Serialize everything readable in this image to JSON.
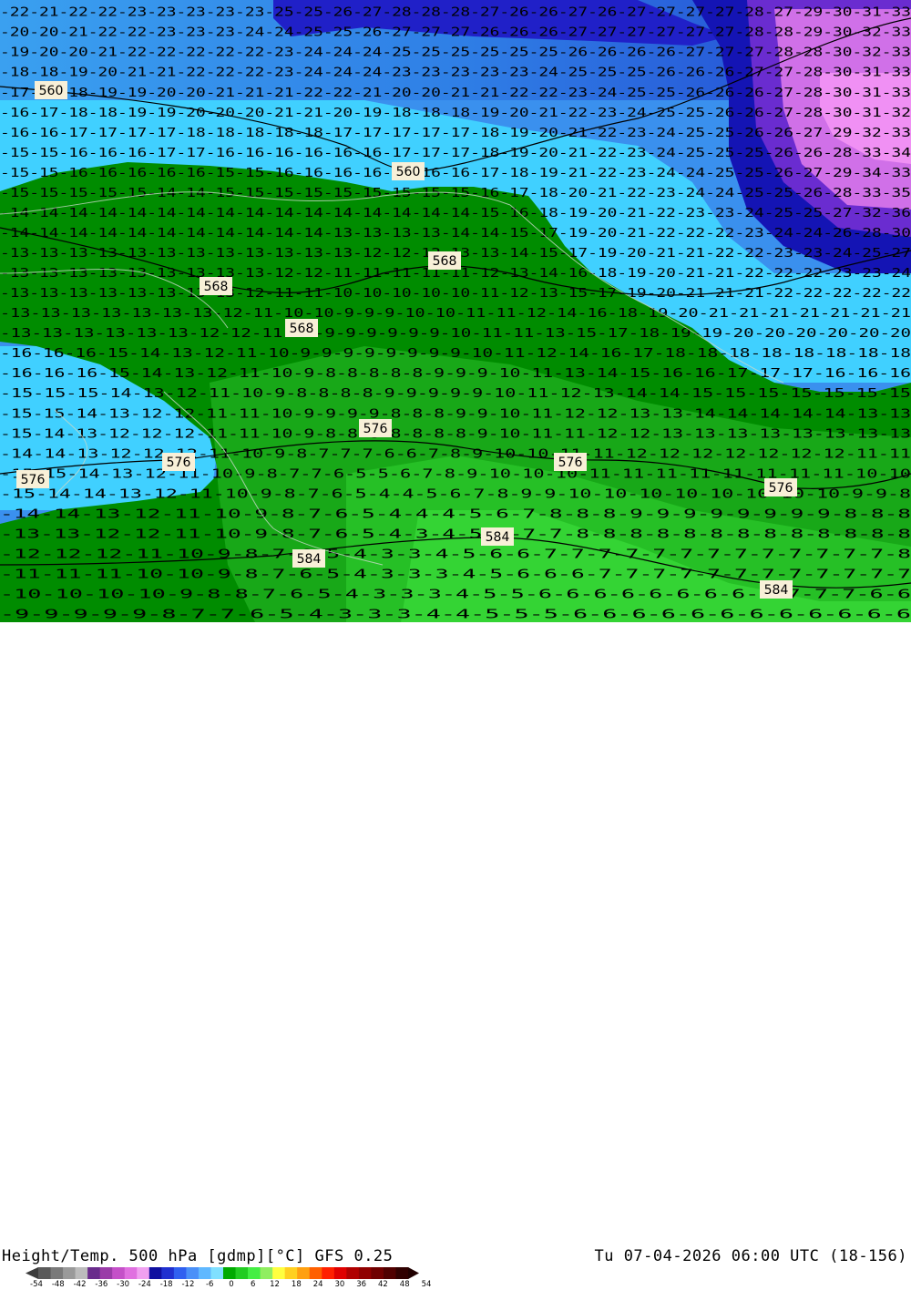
{
  "map": {
    "contour_labels": [
      {
        "text": "560"
      },
      {
        "text": "560"
      },
      {
        "text": "568"
      },
      {
        "text": "568"
      },
      {
        "text": "568"
      },
      {
        "text": "576"
      },
      {
        "text": "576"
      },
      {
        "text": "576"
      },
      {
        "text": "576"
      },
      {
        "text": "576"
      },
      {
        "text": "584"
      },
      {
        "text": "584"
      },
      {
        "text": "584"
      }
    ],
    "temperature_text_rows": [
      "-22-21-22-22-23-23-23-23-23-25-25-26-27-28-28-28-27-26-26-27-26-27-27-27-27-28-27-29-30-31-33",
      "-20-20-21-22-22-23-23-23-24-24-25-25-26-27-27-27-26-26-26-27-27-27-27-27-27-28-28-29-30-32-33",
      "-19-20-20-21-22-22-22-22-22-23-24-24-24-25-25-25-25-25-25-26-26-26-26-27-27-27-28-28-30-32-33",
      "-18-18-19-20-21-21-22-22-22-23-24-24-24-23-23-23-23-23-24-25-25-25-26-26-26-27-27-28-30-31-33",
      "-17-18-18-19-19-20-20-21-21-21-22-22-21-20-20-21-21-22-22-23-24-25-25-26-26-26-27-28-30-31-33",
      "-16-17-18-18-19-19-20-20-20-21-21-20-19-18-18-18-19-20-21-22-23-24-25-25-26-26-27-28-30-31-32",
      "-16-16-17-17-17-17-18-18-18-18-18-17-17-17-17-17-18-19-20-21-22-23-24-25-25-26-26-27-29-32-33",
      "-15-15-16-16-16-17-17-16-16-16-16-16-16-17-17-17-18-19-20-21-22-23-24-25-25-25-26-26-28-33-34",
      "-15-15-16-16-16-16-16-15-15-16-16-16-16-16-16-16-17-18-19-21-22-23-24-24-25-25-26-27-29-34-33",
      "-15-15-15-15-15-14-14-15-15-15-15-15-15-15-15-15-16-17-18-20-21-22-23-24-24-25-25-26-28-33-35",
      "-14-14-14-14-14-14-14-14-14-14-14-14-14-14-14-14-15-16-18-19-20-21-22-23-23-24-25-25-27-32-36",
      "-14-14-14-14-14-14-14-14-14-14-14-13-13-13-13-14-14-15-17-19-20-21-22-22-22-23-24-24-26-28-30",
      "-13-13-13-13-13-13-13-13-13-13-13-13-12-12-12-13-13-14-15-17-19-20-21-21-22-22-23-23-24-25-27",
      "-13-13-13-13-13-13-13-13-13-12-12-11-11-11-11-11-12-13-14-16-18-19-20-21-21-22-22-22-23-23-24",
      "-13-13-13-13-13-13-13-13-12-11-11-10-10-10-10-10-11-12-13-15-17-19-20-21-21-21-22-22-22-22-22",
      "-13-13-13-13-13-13-13-12-11-10-10-9-9-9-10-10-11-11-12-14-16-18-19-20-21-21-21-21-21-21-21",
      "-13-13-13-13-13-13-12-12-11-10-9-9-9-9-9-9-10-11-11-13-15-17-18-19-19-20-20-20-20-20-20",
      "-16-16-16-15-14-13-12-11-10-9-9-9-9-9-9-9-9-10-11-12-14-16-17-18-18-18-18-18-18-18-18",
      "-16-16-16-15-14-13-12-11-10-9-8-8-8-8-8-9-9-9-10-11-13-14-15-16-16-17-17-17-16-16-16",
      "-15-15-15-14-13-12-11-10-9-8-8-8-8-9-9-9-9-9-10-11-12-13-14-14-15-15-15-15-15-15-15",
      "-15-15-14-13-12-12-11-11-10-9-9-9-9-8-8-8-9-9-10-11-12-12-13-13-14-14-14-14-14-13-13",
      "-15-14-13-12-12-12-11-11-10-9-8-8-8-8-8-8-8-9-10-11-11-12-12-13-13-13-13-13-13-13-13",
      "-14-14-13-12-12-12-11-10-9-8-7-7-7-6-6-7-8-9-10-10-11-11-12-12-12-12-12-12-12-11-11",
      "-15-15-14-13-12-11-10-9-8-7-7-6-5-5-6-7-8-9-10-10-10-11-11-11-11-11-11-11-11-10-10",
      "-15-14-14-13-12-11-10-9-8-7-6-5-4-4-5-6-7-8-9-9-10-10-10-10-10-10-10-10-9-9-8",
      "-14-14-13-12-11-10-9-8-7-6-5-4-4-4-5-6-7-8-8-8-9-9-9-9-9-9-9-9-8-8-8",
      "-13-13-12-12-11-10-9-8-7-6-5-4-3-4-5-6-7-7-8-8-8-8-8-8-8-8-8-8-8-8-8",
      "-12-12-12-11-10-9-8-7-6-5-4-3-3-4-5-6-6-7-7-7-7-7-7-7-7-7-7-7-7-7-8",
      "-11-11-11-10-10-9-8-7-6-5-4-3-3-3-4-5-6-6-6-7-7-7-7-7-7-7-7-7-7-7-7",
      "-10-10-10-10-9-8-8-7-6-5-4-3-3-3-4-5-5-6-6-6-6-6-6-6-6-7-7-7-7-6-6",
      "-9-9-9-9-9-8-7-7-6-5-4-3-3-3-4-4-5-5-5-6-6-6-6-6-6-6-6-6-6-6-6"
    ]
  },
  "footer": {
    "title_left": "Height/Temp. 500 hPa [gdmp][°C] GFS 0.25",
    "title_right": "Tu 07-04-2026 06:00 UTC (18-156)",
    "colorbar_labels": [
      "-54",
      "-48",
      "-42",
      "-36",
      "-30",
      "-24",
      "-18",
      "-12",
      "-6",
      "0",
      "6",
      "12",
      "18",
      "24",
      "30",
      "36",
      "42",
      "48",
      "54"
    ],
    "colorbar_colors": [
      "#5a5a5a",
      "#7a7a7a",
      "#9a9a9a",
      "#bcbcbc",
      "#6a2c8c",
      "#9a3ca8",
      "#c450c8",
      "#e070e0",
      "#f0a0f0",
      "#1010a0",
      "#2030d0",
      "#3060f0",
      "#4a90f8",
      "#60b8ff",
      "#80e0ff",
      "#00aa00",
      "#22cc22",
      "#44ee44",
      "#90ee60",
      "#ffff40",
      "#ffd020",
      "#ffa010",
      "#ff6000",
      "#ff2000",
      "#e00000",
      "#b00000",
      "#900000",
      "#700000",
      "#500000",
      "#300000"
    ]
  }
}
